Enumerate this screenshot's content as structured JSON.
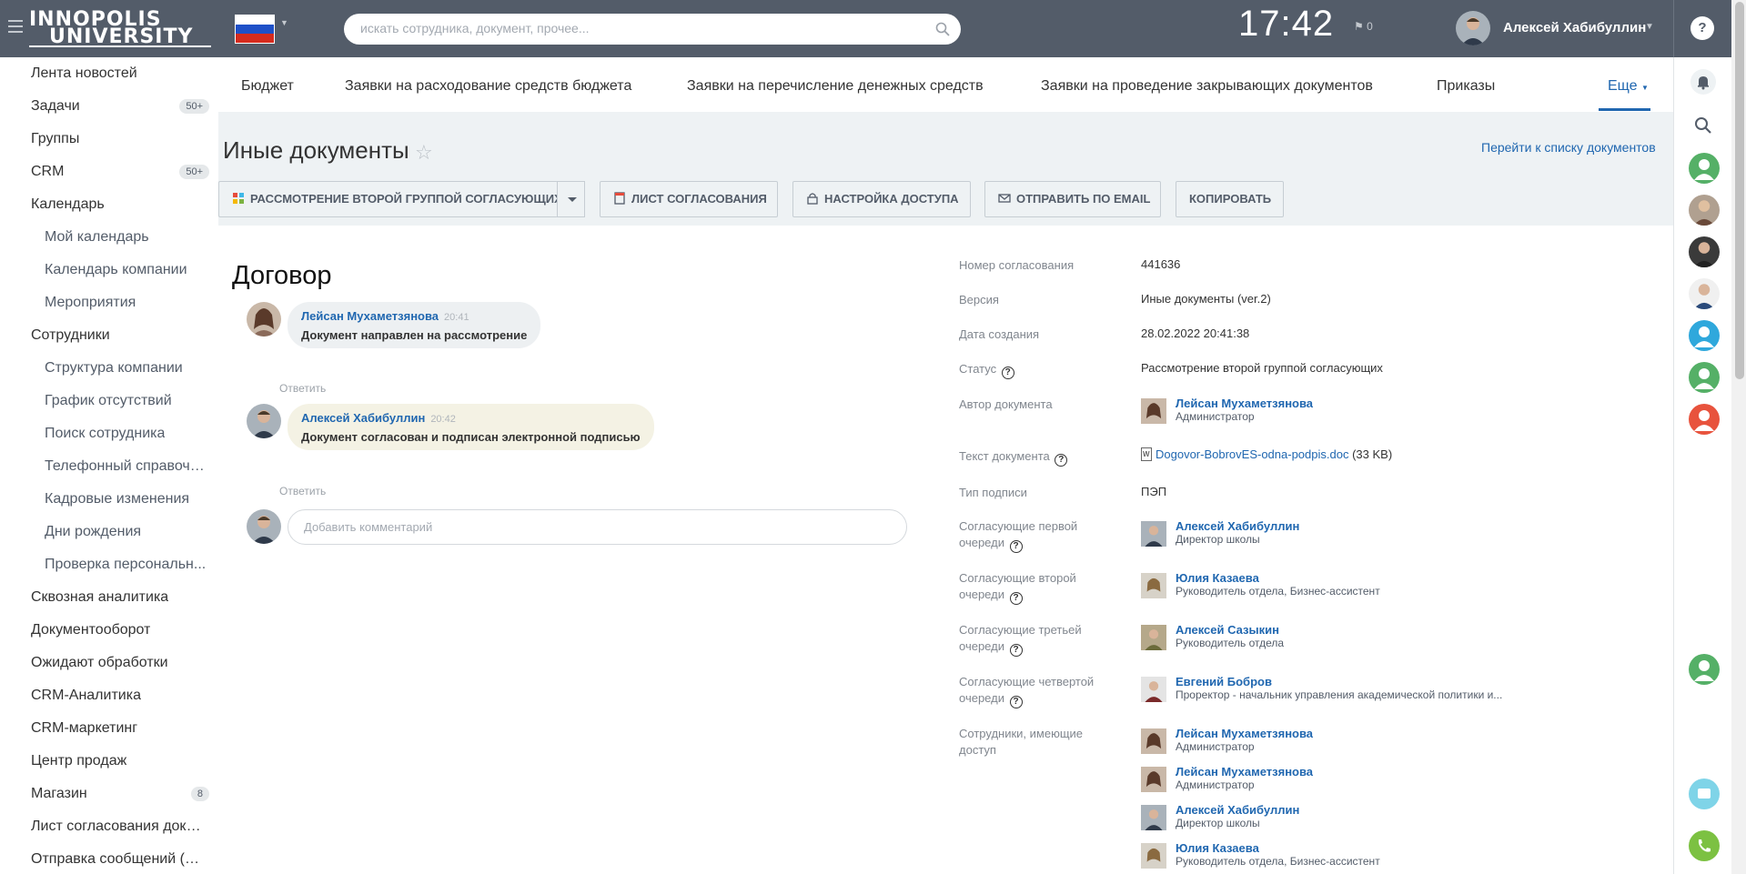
{
  "header": {
    "logo_line1": "INNOPOLIS",
    "logo_line2": "UNIVERSITY",
    "search_placeholder": "искать сотрудника, документ, прочее...",
    "clock": "17:42",
    "flag_count": "0",
    "user_name": "Алексей Хабибуллин",
    "help": "?"
  },
  "sidebar": {
    "items": [
      {
        "label": "Лента новостей",
        "level": 1
      },
      {
        "label": "Задачи",
        "level": 1,
        "badge": "50+"
      },
      {
        "label": "Группы",
        "level": 1
      },
      {
        "label": "CRM",
        "level": 1,
        "badge": "50+"
      },
      {
        "label": "Календарь",
        "level": 1
      },
      {
        "label": "Мой календарь",
        "level": 2
      },
      {
        "label": "Календарь компании",
        "level": 2
      },
      {
        "label": "Мероприятия",
        "level": 2
      },
      {
        "label": "Сотрудники",
        "level": 1
      },
      {
        "label": "Структура компании",
        "level": 2
      },
      {
        "label": "График отсутствий",
        "level": 2
      },
      {
        "label": "Поиск сотрудника",
        "level": 2
      },
      {
        "label": "Телефонный справочн...",
        "level": 2
      },
      {
        "label": "Кадровые изменения",
        "level": 2
      },
      {
        "label": "Дни рождения",
        "level": 2
      },
      {
        "label": "Проверка персональн...",
        "level": 2
      },
      {
        "label": "Сквозная аналитика",
        "level": 1
      },
      {
        "label": "Документооборот",
        "level": 1
      },
      {
        "label": "Ожидают обработки",
        "level": 1
      },
      {
        "label": "CRM-Аналитика",
        "level": 1
      },
      {
        "label": "CRM-маркетинг",
        "level": 1
      },
      {
        "label": "Центр продаж",
        "level": 1
      },
      {
        "label": "Магазин",
        "level": 1,
        "badge": "8"
      },
      {
        "label": "Лист согласования доку...",
        "level": 1
      },
      {
        "label": "Отправка сообщений (С...",
        "level": 1
      }
    ]
  },
  "tabs": [
    "Бюджет",
    "Заявки на расходование средств бюджета",
    "Заявки на перечисление денежных средств",
    "Заявки на проведение закрывающих документов",
    "Приказы",
    "Еще"
  ],
  "page": {
    "title": "Иные документы",
    "doclist_link": "Перейти к списку документов",
    "doc_title": "Договор"
  },
  "toolbar": {
    "status_button": "Рассмотрение второй группой согласующих",
    "sheet_button": "Лист согласования",
    "access_button": "Настройка доступа",
    "email_button": "Отправить по email",
    "copy_button": "Копировать"
  },
  "comments": [
    {
      "author": "Лейсан Мухаметзянова",
      "time": "20:41",
      "text": "Документ направлен на рассмотрение",
      "reply": "Ответить"
    },
    {
      "author": "Алексей Хабибуллин",
      "time": "20:42",
      "text": "Документ согласован и подписан электронной подписью",
      "reply": "Ответить"
    }
  ],
  "add_comment_placeholder": "Добавить комментарий",
  "properties": {
    "number_label": "Номер согласования",
    "number": "441636",
    "version_label": "Версия",
    "version": "Иные документы (ver.2)",
    "created_label": "Дата создания",
    "created": "28.02.2022 20:41:38",
    "status_label": "Статус",
    "status": "Рассмотрение второй группой согласующих",
    "author_label": "Автор документа",
    "author": {
      "name": "Лейсан Мухаметзянова",
      "role": "Администратор"
    },
    "text_label": "Текст документа",
    "file_name": "Dogovor-BobrovES-odna-podpis.doc",
    "file_size": "(33 KB)",
    "sign_label": "Тип подписи",
    "sign": "ПЭП",
    "q1_label": "Согласующие первой очереди",
    "q1": {
      "name": "Алексей Хабибуллин",
      "role": "Директор школы"
    },
    "q2_label": "Согласующие второй очереди",
    "q2": {
      "name": "Юлия Казаева",
      "role": "Руководитель отдела, Бизнес-ассистент"
    },
    "q3_label": "Согласующие третьей очереди",
    "q3": {
      "name": "Алексей Сазыкин",
      "role": "Руководитель отдела"
    },
    "q4_label": "Согласующие четвертой очереди",
    "q4": {
      "name": "Евгений Бобров",
      "role": "Проректор - начальник управления академической политики и..."
    },
    "access_label": "Сотрудники, имеющие доступ",
    "access": [
      {
        "name": "Лейсан Мухаметзянова",
        "role": "Администратор"
      },
      {
        "name": "Лейсан Мухаметзянова",
        "role": "Администратор"
      },
      {
        "name": "Алексей Хабибуллин",
        "role": "Директор школы"
      },
      {
        "name": "Юлия Казаева",
        "role": "Руководитель отдела, Бизнес-ассистент"
      }
    ]
  },
  "colors": {
    "header_bg": "#535c69",
    "link": "#2067b0",
    "page_bg": "#eef2f4"
  }
}
